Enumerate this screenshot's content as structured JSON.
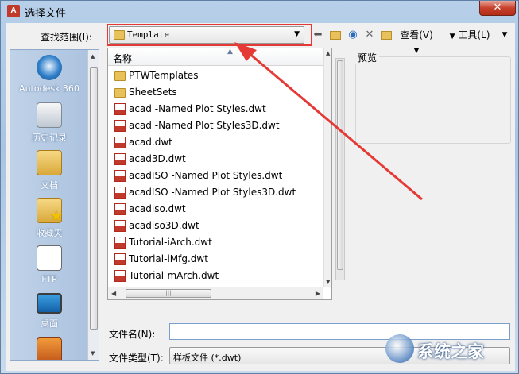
{
  "window": {
    "title": "选择文件",
    "close_label": "✕"
  },
  "toolbar": {
    "lookin_label": "查找范围(I):",
    "lookin_value": "Template",
    "view_label": "查看(V)",
    "tools_label": "工具(L)"
  },
  "places": [
    {
      "label": "Autodesk 360",
      "icon": "cloud-icon"
    },
    {
      "label": "历史记录",
      "icon": "history-icon"
    },
    {
      "label": "文档",
      "icon": "documents-icon"
    },
    {
      "label": "收藏夹",
      "icon": "favorites-icon"
    },
    {
      "label": "FTP",
      "icon": "ftp-icon"
    },
    {
      "label": "桌面",
      "icon": "desktop-icon"
    },
    {
      "label": "",
      "icon": "bag-icon"
    }
  ],
  "filelist": {
    "column_name": "名称",
    "items": [
      {
        "name": "PTWTemplates",
        "type": "folder"
      },
      {
        "name": "SheetSets",
        "type": "folder"
      },
      {
        "name": "acad -Named Plot Styles.dwt",
        "type": "dwt"
      },
      {
        "name": "acad -Named Plot Styles3D.dwt",
        "type": "dwt"
      },
      {
        "name": "acad.dwt",
        "type": "dwt"
      },
      {
        "name": "acad3D.dwt",
        "type": "dwt"
      },
      {
        "name": "acadISO -Named Plot Styles.dwt",
        "type": "dwt"
      },
      {
        "name": "acadISO -Named Plot Styles3D.dwt",
        "type": "dwt"
      },
      {
        "name": "acadiso.dwt",
        "type": "dwt"
      },
      {
        "name": "acadiso3D.dwt",
        "type": "dwt"
      },
      {
        "name": "Tutorial-iArch.dwt",
        "type": "dwt"
      },
      {
        "name": "Tutorial-iMfg.dwt",
        "type": "dwt"
      },
      {
        "name": "Tutorial-mArch.dwt",
        "type": "dwt"
      }
    ]
  },
  "preview": {
    "label": "预览"
  },
  "filename": {
    "label": "文件名(N):",
    "value": ""
  },
  "filetype": {
    "label": "文件类型(T):",
    "value": "样板文件 (*.dwt)"
  },
  "watermark": {
    "text": "系统之家"
  },
  "colors": {
    "annotation_red": "#e53935",
    "title_gradient": "#b7cfe9",
    "places_bg": "#a9c1de"
  }
}
